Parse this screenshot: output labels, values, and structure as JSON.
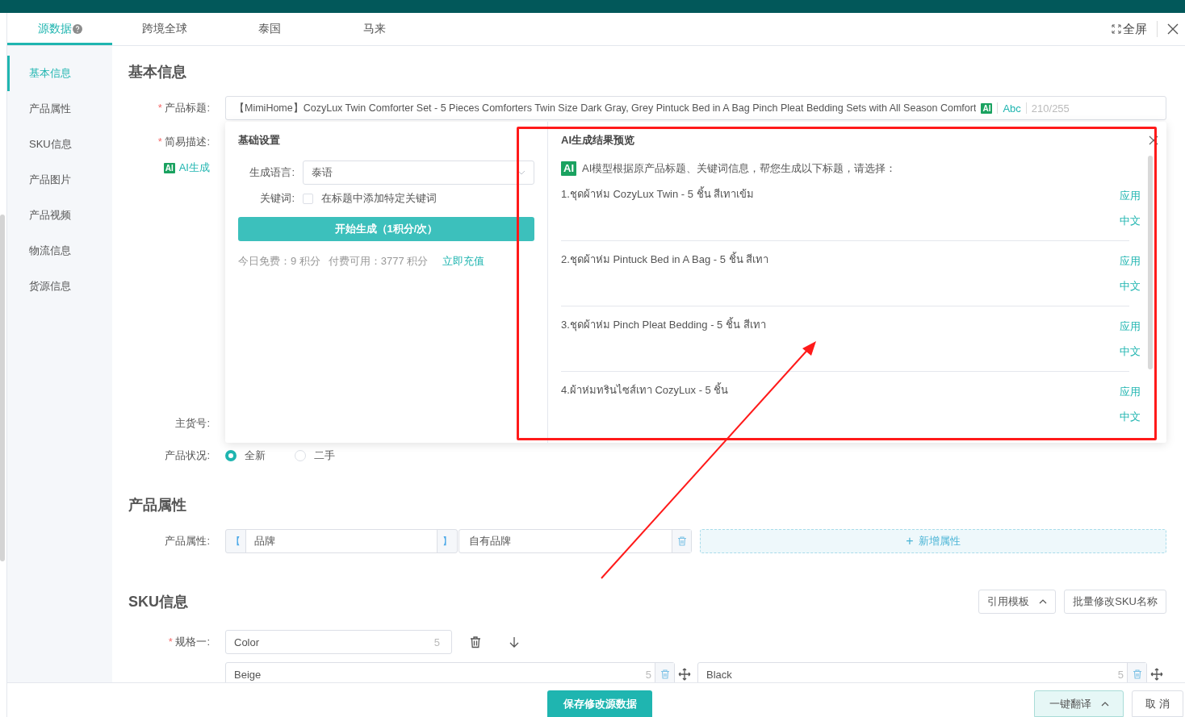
{
  "tabs": [
    {
      "label": "源数据",
      "selected": true,
      "help": true
    },
    {
      "label": "跨境全球",
      "selected": false,
      "help": false
    },
    {
      "label": "泰国",
      "selected": false,
      "help": false
    },
    {
      "label": "马来",
      "selected": false,
      "help": false
    }
  ],
  "fullscreen": "全屏",
  "sidebar": {
    "items": [
      {
        "label": "基本信息",
        "selected": true
      },
      {
        "label": "产品属性",
        "selected": false
      },
      {
        "label": "SKU信息",
        "selected": false
      },
      {
        "label": "产品图片",
        "selected": false
      },
      {
        "label": "产品视频",
        "selected": false
      },
      {
        "label": "物流信息",
        "selected": false
      },
      {
        "label": "货源信息",
        "selected": false
      }
    ]
  },
  "basic": {
    "title": "基本信息",
    "product_title": {
      "required_mark": "*",
      "label": "产品标题:",
      "value": "【MimiHome】CozyLux Twin Comforter Set - 5 Pieces Comforters Twin Size Dark Gray, Grey Pintuck Bed in A Bag Pinch Pleat Bedding Sets with All Season Comfort",
      "ai_badge": "AI",
      "abc": "Abc",
      "count": "210/255"
    },
    "description": {
      "required_mark": "*",
      "label": "简易描述:",
      "ai_badge": "AI",
      "ai_link": "AI生成"
    },
    "sku_no": {
      "label": "主货号:"
    },
    "condition": {
      "label": "产品状况:",
      "options": [
        {
          "label": "全新",
          "selected": true
        },
        {
          "label": "二手",
          "selected": false
        }
      ]
    }
  },
  "attributes": {
    "title": "产品属性",
    "label": "产品属性:",
    "rows": [
      {
        "bracket_left": "【",
        "name": "品牌",
        "bracket_right": "】",
        "value": "自有品牌"
      }
    ],
    "add_icon": "+",
    "add": "新增属性"
  },
  "sku": {
    "title": "SKU信息",
    "buttons": [
      {
        "label": "引用模板",
        "caret": true
      },
      {
        "label": "批量修改SKU名称",
        "caret": false
      }
    ],
    "spec": {
      "required_mark": "*",
      "label": "规格一:",
      "value": "Color",
      "count": "5"
    },
    "values": [
      {
        "value": "Beige",
        "count": "5"
      },
      {
        "value": "Black",
        "count": "5"
      }
    ]
  },
  "popover": {
    "settings": {
      "title": "基础设置",
      "language_label": "生成语言:",
      "language": "泰语",
      "keyword_label": "关键词:",
      "keyword_checked": false,
      "keyword_text": "在标题中添加特定关键词",
      "generate": "开始生成（1积分/次）",
      "free": "今日免费：9 积分",
      "paid": "付费可用：3777 积分",
      "recharge": "立即充值"
    },
    "preview": {
      "title": "AI生成结果预览",
      "badge": "AI",
      "intro": "AI模型根据原产品标题、关键词信息，帮您生成以下标题，请选择：",
      "results": [
        {
          "text": "1.ชุดผ้าห่ม CozyLux Twin - 5 ชิ้น สีเทาเข้ม",
          "apply": "应用",
          "translate": "中文"
        },
        {
          "text": "2.ชุดผ้าห่ม Pintuck Bed in A Bag - 5 ชิ้น สีเทา",
          "apply": "应用",
          "translate": "中文"
        },
        {
          "text": "3.ชุดผ้าห่ม Pinch Pleat Bedding - 5 ชิ้น สีเทา",
          "apply": "应用",
          "translate": "中文"
        },
        {
          "text": "4.ผ้าห่มทรินไซส์เทา CozyLux - 5 ชิ้น",
          "apply": "应用",
          "translate": "中文"
        }
      ]
    }
  },
  "footer": {
    "save": "保存修改源数据",
    "translate": "一键翻译",
    "cancel": "取 消"
  }
}
